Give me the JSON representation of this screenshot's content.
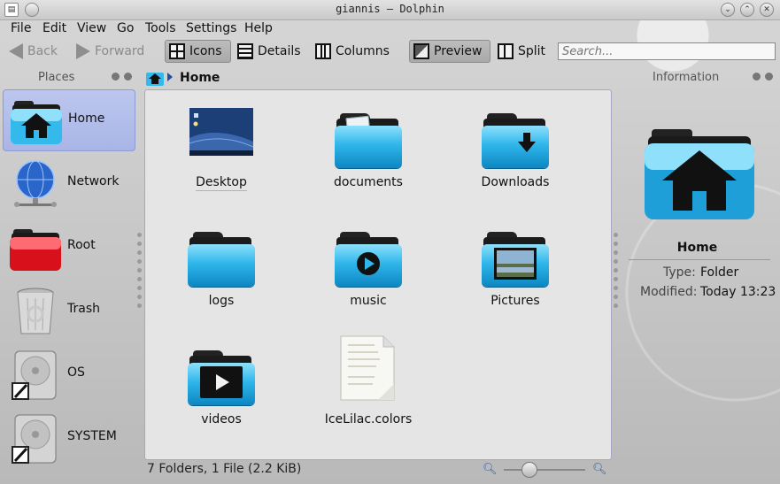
{
  "window": {
    "title": "giannis – Dolphin"
  },
  "menu": [
    "File",
    "Edit",
    "View",
    "Go",
    "Tools",
    "Settings",
    "Help"
  ],
  "toolbar": {
    "back": "Back",
    "forward": "Forward",
    "icons": "Icons",
    "details": "Details",
    "columns": "Columns",
    "preview": "Preview",
    "split": "Split",
    "search_placeholder": "Search..."
  },
  "places": {
    "title": "Places",
    "items": [
      {
        "label": "Home",
        "icon": "home-folder-icon",
        "selected": true
      },
      {
        "label": "Network",
        "icon": "network-globe-icon"
      },
      {
        "label": "Root",
        "icon": "root-folder-icon"
      },
      {
        "label": "Trash",
        "icon": "trash-icon"
      },
      {
        "label": "OS",
        "icon": "hard-drive-icon"
      },
      {
        "label": "SYSTEM",
        "icon": "hard-drive-icon"
      }
    ]
  },
  "breadcrumb": {
    "current": "Home"
  },
  "files": [
    {
      "name": "Desktop",
      "kind": "desktop-folder"
    },
    {
      "name": "documents",
      "kind": "folder"
    },
    {
      "name": "Downloads",
      "kind": "folder"
    },
    {
      "name": "logs",
      "kind": "folder"
    },
    {
      "name": "music",
      "kind": "folder"
    },
    {
      "name": "Pictures",
      "kind": "folder"
    },
    {
      "name": "videos",
      "kind": "folder"
    },
    {
      "name": "IceLilac.colors",
      "kind": "text-file"
    }
  ],
  "status": {
    "text": "7 Folders, 1 File (2.2 KiB)",
    "zoom_level": 0.3
  },
  "info": {
    "title": "Information",
    "name": "Home",
    "type_label": "Type:",
    "type_value": "Folder",
    "modified_label": "Modified:",
    "modified_value": "Today 13:23"
  },
  "colors": {
    "accent": "#2fb6ea",
    "selection": "#b0bbea",
    "view_bg": "#e5e5e5"
  }
}
